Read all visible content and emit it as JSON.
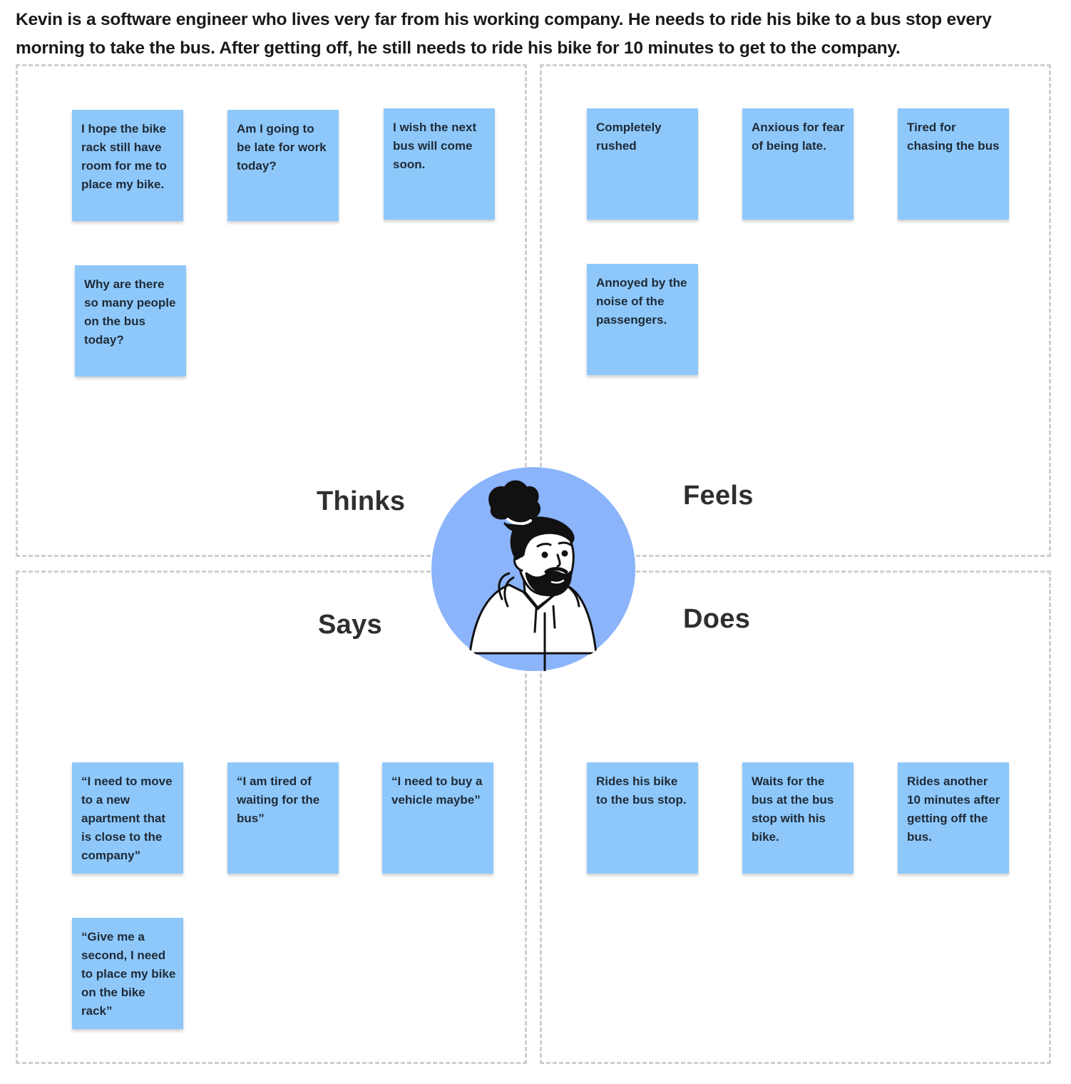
{
  "persona_description": "Kevin is a software engineer who lives very far from his working company. He needs to ride his bike to a bus stop every morning to take the bus. After getting off, he still needs to ride his bike for 10 minutes to get to the company.",
  "colors": {
    "sticky_note": "#8ec8fb",
    "avatar_circle": "#8bb4fa",
    "quadrant_border": "#cfcfcf"
  },
  "quadrants": {
    "thinks": {
      "label": "Thinks",
      "notes": [
        "I hope the bike rack still have room for me to place my bike.",
        "Am I going to be late for work today?",
        "I wish the next bus will come soon.",
        "Why are there so many people on the bus today?"
      ]
    },
    "feels": {
      "label": "Feels",
      "notes": [
        "Completely rushed",
        "Anxious for fear of being late.",
        "Tired for chasing the bus",
        "Annoyed by the noise of the passengers."
      ]
    },
    "says": {
      "label": "Says",
      "notes": [
        "“I need to move to a new apartment that is close to the company”",
        "“I am tired of waiting for the bus”",
        "“I need to buy a vehicle maybe”",
        "“Give me a second, I need to place my bike on the bike rack”"
      ]
    },
    "does": {
      "label": "Does",
      "notes": [
        "Rides his bike to the bus stop.",
        "Waits for the bus at the bus stop with his bike.",
        "Rides another 10 minutes after getting off the bus."
      ]
    }
  },
  "avatar": {
    "icon": "person-avatar-icon"
  }
}
